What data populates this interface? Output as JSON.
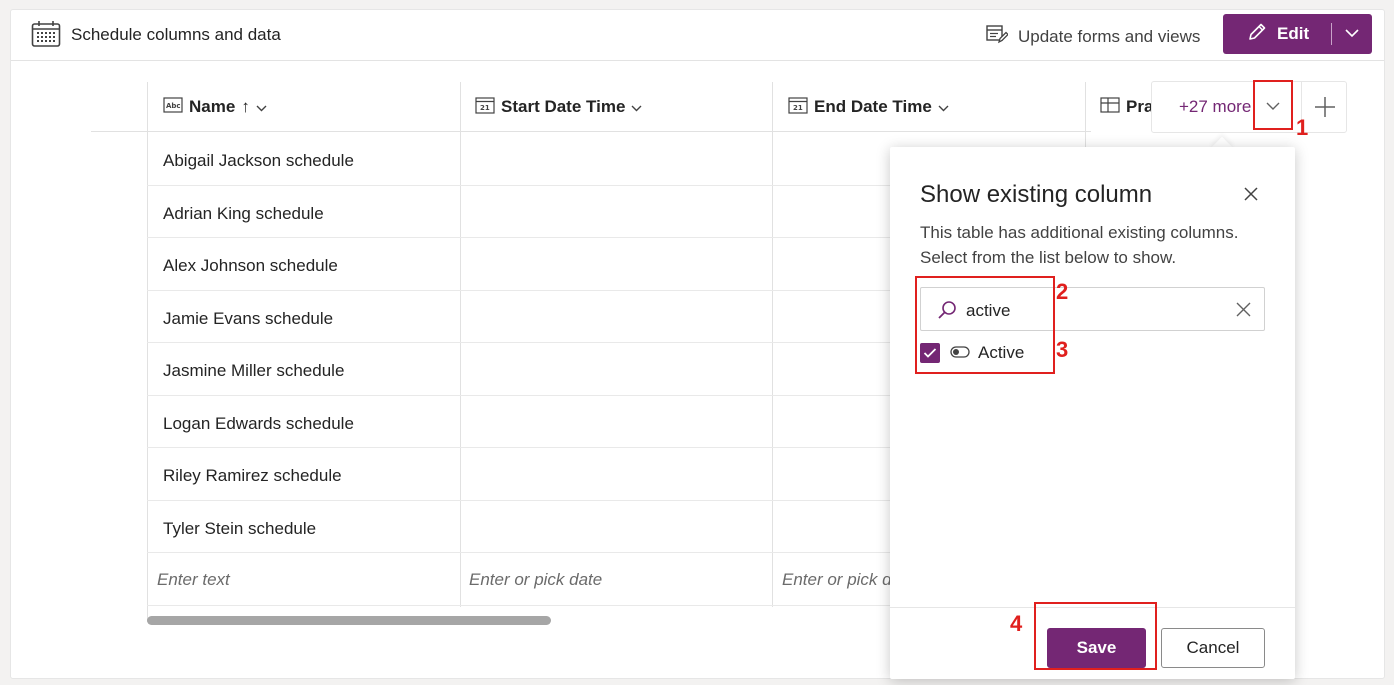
{
  "header": {
    "title": "Schedule columns and data",
    "update_link": "Update forms and views",
    "edit_label": "Edit"
  },
  "grid": {
    "columns": [
      {
        "label": "Name",
        "sort_indicator": "↑"
      },
      {
        "label": "Start Date Time"
      },
      {
        "label": "End Date Time"
      },
      {
        "label": "Pra"
      }
    ],
    "rows": [
      "Abigail Jackson schedule",
      "Adrian King schedule",
      "Alex Johnson schedule",
      "Jamie Evans schedule",
      "Jasmine Miller schedule",
      "Logan Edwards schedule",
      "Riley Ramirez schedule",
      "Tyler Stein schedule"
    ],
    "new_row_placeholders": [
      "Enter text",
      "Enter or pick date",
      "Enter or pick d"
    ],
    "more_columns_label": "+27 more"
  },
  "panel": {
    "title": "Show existing column",
    "description": "This table has additional existing columns. Select from the list below to show.",
    "search_value": "active",
    "option_label": "Active",
    "option_checked": true,
    "save_label": "Save",
    "cancel_label": "Cancel"
  },
  "annotations": [
    "1",
    "2",
    "3",
    "4"
  ],
  "colors": {
    "accent": "#742774",
    "annotation": "#e0201e"
  }
}
